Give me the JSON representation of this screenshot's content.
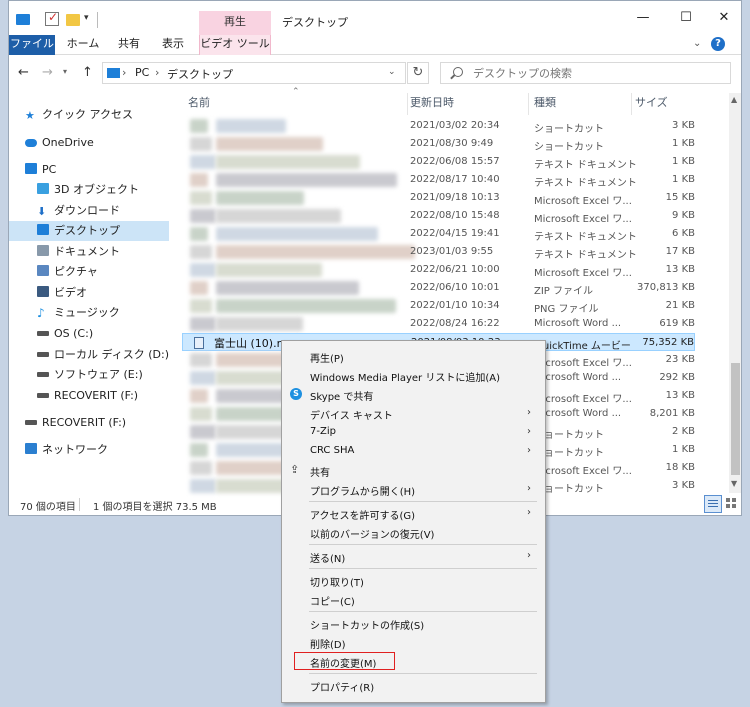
{
  "titlebar": {
    "context_tab": "再生",
    "title": "デスクトップ"
  },
  "ribbon": {
    "tabs": [
      "ファイル",
      "ホーム",
      "共有",
      "表示",
      "ビデオ ツール"
    ]
  },
  "address": {
    "segments": [
      "PC",
      "デスクトップ"
    ],
    "search_placeholder": "デスクトップの検索"
  },
  "nav": {
    "items": [
      {
        "label": "クイック アクセス",
        "icon": "star-icon"
      },
      {
        "label": "OneDrive",
        "icon": "cloud-icon"
      },
      {
        "label": "PC",
        "icon": "pc-icon"
      },
      {
        "label": "3D オブジェクト",
        "icon": "cube-icon"
      },
      {
        "label": "ダウンロード",
        "icon": "download-icon"
      },
      {
        "label": "デスクトップ",
        "icon": "desktop-icon",
        "selected": true
      },
      {
        "label": "ドキュメント",
        "icon": "document-icon"
      },
      {
        "label": "ピクチャ",
        "icon": "picture-icon"
      },
      {
        "label": "ビデオ",
        "icon": "video-icon"
      },
      {
        "label": "ミュージック",
        "icon": "music-icon"
      },
      {
        "label": "OS (C:)",
        "icon": "drive-icon"
      },
      {
        "label": "ローカル ディスク (D:)",
        "icon": "drive-icon"
      },
      {
        "label": "ソフトウェア (E:)",
        "icon": "drive-icon"
      },
      {
        "label": "RECOVERIT (F:)",
        "icon": "drive-icon"
      },
      {
        "label": "RECOVERIT (F:)",
        "icon": "drive-icon"
      },
      {
        "label": "ネットワーク",
        "icon": "network-icon"
      }
    ]
  },
  "columns": {
    "name": "名前",
    "date": "更新日時",
    "type": "種類",
    "size": "サイズ"
  },
  "files": [
    {
      "date": "2021/03/02 20:34",
      "type": "ショートカット",
      "size": "3 KB"
    },
    {
      "date": "2021/08/30 9:49",
      "type": "ショートカット",
      "size": "1 KB"
    },
    {
      "date": "2022/06/08 15:57",
      "type": "テキスト ドキュメント",
      "size": "1 KB"
    },
    {
      "date": "2022/08/17 10:40",
      "type": "テキスト ドキュメント",
      "size": "1 KB"
    },
    {
      "date": "2021/09/18 10:13",
      "type": "Microsoft Excel ワ...",
      "size": "15 KB"
    },
    {
      "date": "2022/08/10 15:48",
      "type": "Microsoft Excel ワ...",
      "size": "9 KB"
    },
    {
      "date": "2022/04/15 19:41",
      "type": "テキスト ドキュメント",
      "size": "6 KB"
    },
    {
      "date": "2023/01/03 9:55",
      "type": "テキスト ドキュメント",
      "size": "17 KB"
    },
    {
      "date": "2022/06/21 10:00",
      "type": "Microsoft Excel ワ...",
      "size": "13 KB"
    },
    {
      "date": "2022/06/10 10:01",
      "type": "ZIP ファイル",
      "size": "370,813 KB"
    },
    {
      "date": "2022/01/10 10:34",
      "type": "PNG ファイル",
      "size": "21 KB"
    },
    {
      "date": "2022/08/24 16:22",
      "type": "Microsoft Word ...",
      "size": "619 KB"
    },
    {
      "name": "富士山 (10).mov",
      "date": "2021/08/03 10:23",
      "type": "QuickTime ムービー",
      "size": "75,352 KB",
      "selected": true
    },
    {
      "date": "",
      "type": "Microsoft Excel ワ...",
      "size": "23 KB"
    },
    {
      "date": "",
      "type": "Microsoft Word ...",
      "size": "292 KB"
    },
    {
      "date": "",
      "type": "Microsoft Excel ワ...",
      "size": "13 KB"
    },
    {
      "date": "",
      "type": "Microsoft Word ...",
      "size": "8,201 KB"
    },
    {
      "date": "",
      "type": "ショートカット",
      "size": "2 KB"
    },
    {
      "date": "",
      "type": "ショートカット",
      "size": "1 KB"
    },
    {
      "date": "",
      "type": "Microsoft Excel ワ...",
      "size": "18 KB"
    },
    {
      "date": "",
      "type": "ショートカット",
      "size": "3 KB"
    }
  ],
  "status": {
    "count": "70 個の項目",
    "selection": "1 個の項目を選択  73.5 MB"
  },
  "context_menu": {
    "items": [
      {
        "label": "再生(P)"
      },
      {
        "label": "Windows Media Player リストに追加(A)"
      },
      {
        "label": "Skype で共有",
        "icon": "skype-icon"
      },
      {
        "label": "デバイス キャスト",
        "submenu": true
      },
      {
        "label": "7-Zip",
        "submenu": true
      },
      {
        "label": "CRC SHA",
        "submenu": true
      },
      {
        "label": "共有",
        "icon": "share-icon"
      },
      {
        "label": "プログラムから開く(H)",
        "submenu": true
      },
      {
        "sep": true
      },
      {
        "label": "アクセスを許可する(G)",
        "submenu": true
      },
      {
        "label": "以前のバージョンの復元(V)"
      },
      {
        "sep": true
      },
      {
        "label": "送る(N)",
        "submenu": true
      },
      {
        "sep": true
      },
      {
        "label": "切り取り(T)"
      },
      {
        "label": "コピー(C)"
      },
      {
        "sep": true
      },
      {
        "label": "ショートカットの作成(S)"
      },
      {
        "label": "削除(D)"
      },
      {
        "label": "名前の変更(M)",
        "highlighted": true
      },
      {
        "sep": true
      },
      {
        "label": "プロパティ(R)"
      }
    ]
  },
  "colors": {
    "accent": "#1d5ea8",
    "selection": "#cce8ff",
    "nav_selection": "#cce4f7",
    "highlight_box": "#e02020",
    "video_tools_tab": "#f9d3e1"
  }
}
